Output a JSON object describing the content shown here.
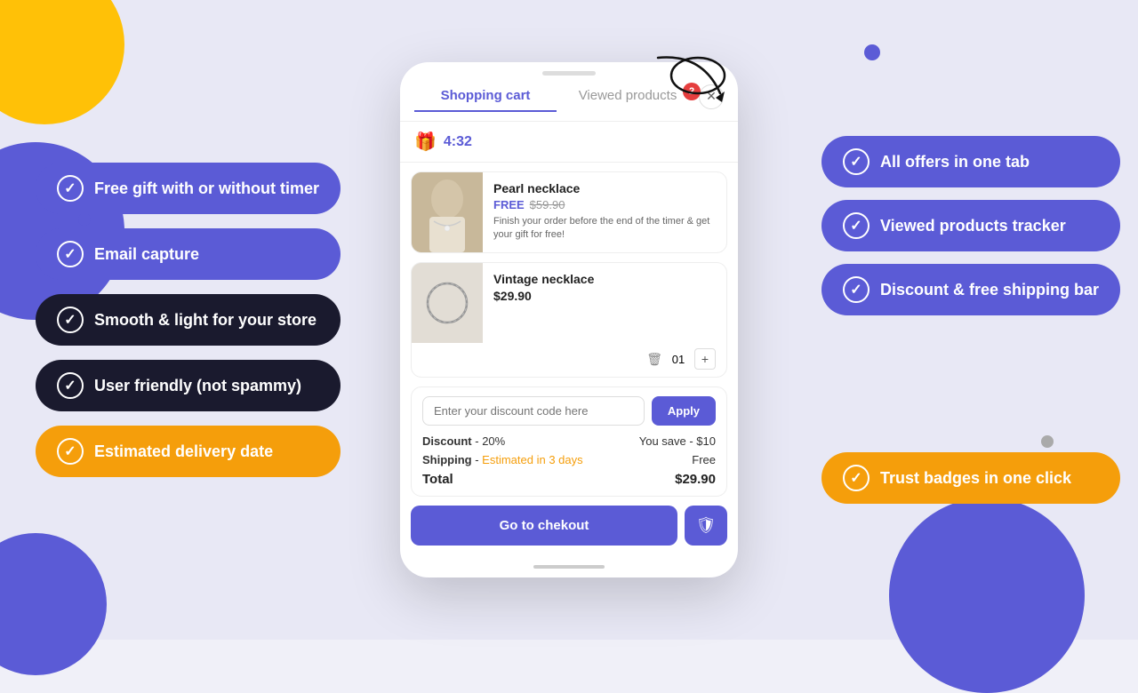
{
  "background": {
    "color": "#e8e8f5"
  },
  "left_features": [
    {
      "id": "free-gift",
      "text": "Free gift with or without timer",
      "style": "blue"
    },
    {
      "id": "email-capture",
      "text": "Email capture",
      "style": "blue"
    },
    {
      "id": "smooth",
      "text": "Smooth & light for your store",
      "style": "dark"
    },
    {
      "id": "user-friendly",
      "text": "User friendly (not spammy)",
      "style": "dark"
    },
    {
      "id": "estimated-delivery",
      "text": "Estimated delivery date",
      "style": "orange"
    }
  ],
  "right_features": [
    {
      "id": "all-offers",
      "text": "All offers in one tab",
      "style": "blue"
    },
    {
      "id": "viewed-products",
      "text": "Viewed products tracker",
      "style": "blue"
    },
    {
      "id": "discount-shipping",
      "text": "Discount & free shipping bar",
      "style": "blue"
    },
    {
      "id": "trust-badges",
      "text": "Trust badges in one click",
      "style": "orange"
    }
  ],
  "phone": {
    "tabs": [
      {
        "id": "shopping-cart",
        "label": "Shopping cart",
        "active": true
      },
      {
        "id": "viewed-products-tab",
        "label": "Viewed products",
        "active": false
      }
    ],
    "badge_count": "2",
    "timer": {
      "icon": "🎁",
      "time": "4:32"
    },
    "products": [
      {
        "id": "pearl-necklace",
        "name": "Pearl necklace",
        "price_label": "FREE",
        "price_original": "$59.90",
        "description": "Finish your order before the end of the timer & get your gift for free!",
        "is_free": true
      },
      {
        "id": "vintage-necklace",
        "name": "Vintage necklace",
        "price": "$29.90",
        "quantity": "01",
        "is_free": false
      }
    ],
    "discount": {
      "input_placeholder": "Enter your discount code here",
      "apply_label": "Apply"
    },
    "summary": {
      "discount_label": "Discount",
      "discount_value": "- 20%",
      "discount_save_label": "You save - $10",
      "shipping_label": "Shipping",
      "shipping_estimate": "Estimated in 3 days",
      "shipping_value": "Free",
      "total_label": "Total",
      "total_value": "$29.90"
    },
    "checkout_label": "Go to chekout"
  }
}
